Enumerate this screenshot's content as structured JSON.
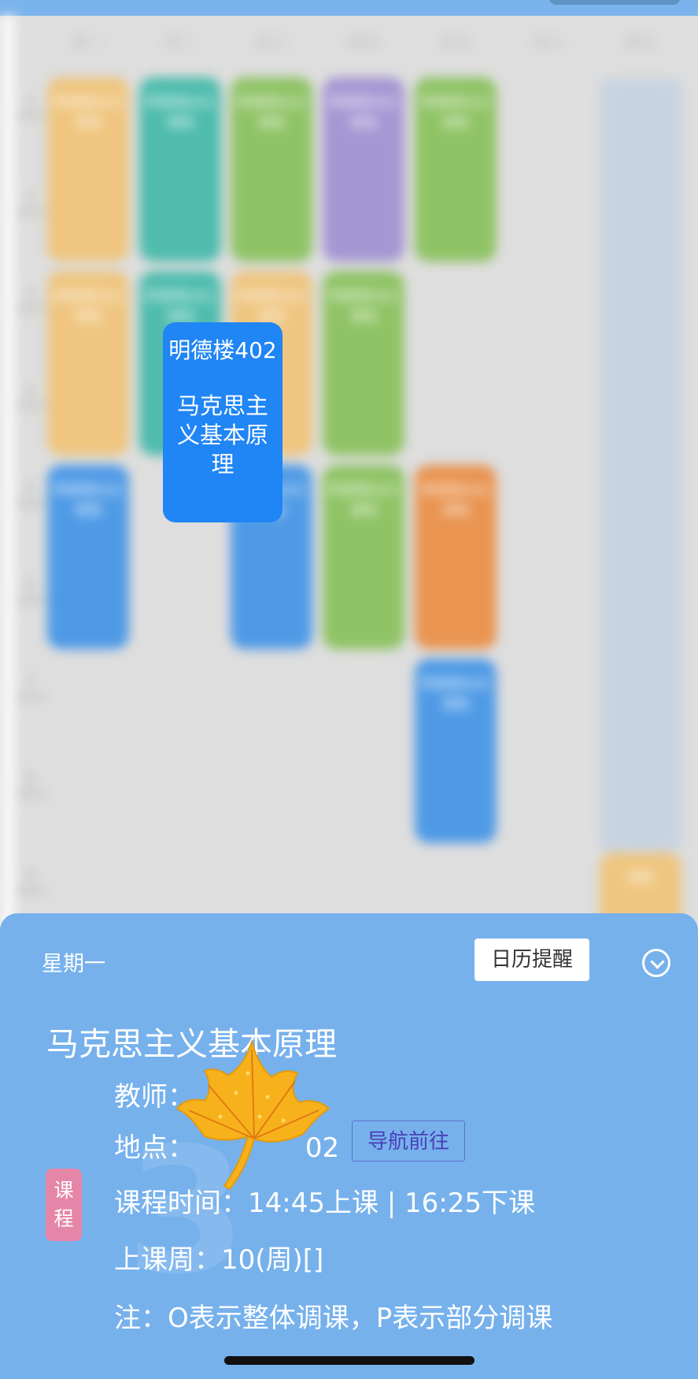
{
  "timetable": {
    "days": [
      "周一",
      "周二",
      "周三",
      "周四",
      "周五",
      "周六",
      "周日"
    ],
    "sections": [
      "1",
      "2",
      "3",
      "4",
      "5",
      "6",
      "7",
      "8",
      "9"
    ],
    "blurred_cells": [
      {
        "day": 0,
        "start": 1,
        "end": 2,
        "color": "orange",
        "text": "明德楼402 课程"
      },
      {
        "day": 1,
        "start": 1,
        "end": 2,
        "color": "teal",
        "text": "明德楼402 课程"
      },
      {
        "day": 2,
        "start": 1,
        "end": 2,
        "color": "green",
        "text": "明德楼402 课程"
      },
      {
        "day": 3,
        "start": 1,
        "end": 2,
        "color": "purple",
        "text": "明德楼402 课程"
      },
      {
        "day": 4,
        "start": 1,
        "end": 2,
        "color": "green",
        "text": "明德楼402 课程"
      },
      {
        "day": 0,
        "start": 3,
        "end": 4,
        "color": "orange",
        "text": "明德楼402 课程"
      },
      {
        "day": 1,
        "start": 3,
        "end": 4,
        "color": "teal",
        "text": "明德楼402 课程"
      },
      {
        "day": 2,
        "start": 3,
        "end": 4,
        "color": "orange",
        "text": "明德楼402 课程"
      },
      {
        "day": 3,
        "start": 3,
        "end": 4,
        "color": "green",
        "text": "明德楼402 课程"
      },
      {
        "day": 0,
        "start": 5,
        "end": 6,
        "color": "blue",
        "text": "明德楼402 课程"
      },
      {
        "day": 2,
        "start": 5,
        "end": 6,
        "color": "blue",
        "text": "明德楼402 课程"
      },
      {
        "day": 3,
        "start": 5,
        "end": 6,
        "color": "green",
        "text": "明德楼402 课程"
      },
      {
        "day": 4,
        "start": 5,
        "end": 6,
        "color": "deeporange",
        "text": "明德楼402 课程"
      },
      {
        "day": 4,
        "start": 7,
        "end": 8,
        "color": "blue",
        "text": "明德楼402 课程"
      },
      {
        "day": 6,
        "start": 9,
        "end": 9,
        "color": "orange",
        "text": "课程"
      }
    ]
  },
  "focused_course": {
    "location": "明德楼402",
    "name": "马克思主义基本原理"
  },
  "detail_sheet": {
    "weekday": "星期一",
    "calendar_button": "日历提醒",
    "course_title": "马克思主义基本原理",
    "teacher_label": "教师：",
    "location_label": "地点：",
    "location_value": "02",
    "navigate_button": "导航前往",
    "tag": "课程",
    "time_line": "课程时间：14:45上课 | 16:25下课",
    "weeks_line": "上课周：10(周)[]",
    "note_line": "注：O表示整体调课，P表示部分调课",
    "background_number": "3"
  },
  "colors": {
    "sheet_bg": "#76b1ec",
    "focus_card": "#2085f5",
    "tag_bg": "#e586a8",
    "nav_border": "#5b71cf"
  }
}
